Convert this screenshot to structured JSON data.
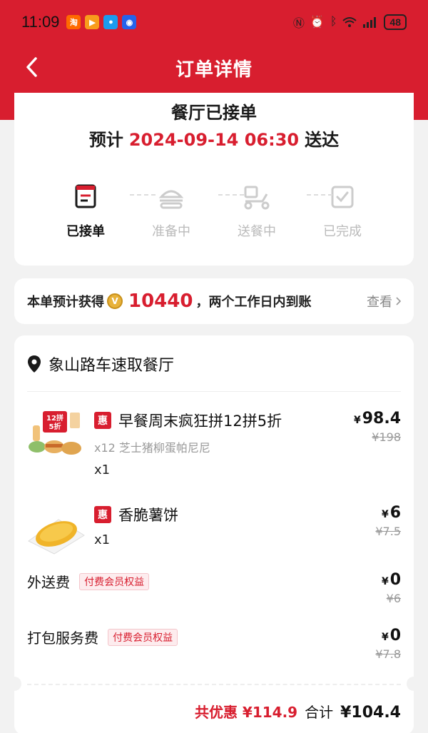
{
  "status_bar": {
    "time": "11:09",
    "apps": [
      {
        "glyph": "淘",
        "color": "#ff6a00"
      },
      {
        "glyph": "▶",
        "color": "#f89c1c"
      },
      {
        "glyph": "●",
        "color": "#1c9bef"
      },
      {
        "glyph": "◉",
        "color": "#2563eb"
      }
    ],
    "battery": "48"
  },
  "header": {
    "title": "订单详情"
  },
  "status_card": {
    "title": "餐厅已接单",
    "eta_prefix": "预计",
    "eta_datetime": "2024-09-14 06:30",
    "eta_suffix": "送达",
    "steps": [
      {
        "label": "已接单",
        "icon": "receipt-icon",
        "active": true
      },
      {
        "label": "准备中",
        "icon": "burger-icon",
        "active": false
      },
      {
        "label": "送餐中",
        "icon": "scooter-icon",
        "active": false
      },
      {
        "label": "已完成",
        "icon": "check-bag-icon",
        "active": false
      }
    ]
  },
  "points_card": {
    "prefix": "本单预计获得",
    "coin_label": "V",
    "points": "10440",
    "suffix": "，两个工作日内到账",
    "view_label": "查看"
  },
  "order_card": {
    "store_name": "象山路车速取餐厅",
    "items": [
      {
        "badge": "惠",
        "name": "早餐周末疯狂拼12拼5折",
        "sub": "x12 芝士猪柳蛋帕尼尼",
        "qty": "x1",
        "price": "98.4",
        "original_price": "¥198",
        "promo_text": "12拼\n5折"
      },
      {
        "badge": "惠",
        "name": "香脆薯饼",
        "sub": "",
        "qty": "x1",
        "price": "6",
        "original_price": "¥7.5"
      }
    ],
    "fees": [
      {
        "label": "外送费",
        "badge": "付费会员权益",
        "price": "0",
        "original_price": "¥6"
      },
      {
        "label": "打包服务费",
        "badge": "付费会员权益",
        "price": "0",
        "original_price": "¥7.8"
      }
    ],
    "currency": "¥",
    "discount_label": "共优惠 ¥114.9",
    "total_label": "合计",
    "total_value": "¥104.4"
  },
  "colors": {
    "brand_red": "#d81e2f",
    "muted": "#999999"
  }
}
